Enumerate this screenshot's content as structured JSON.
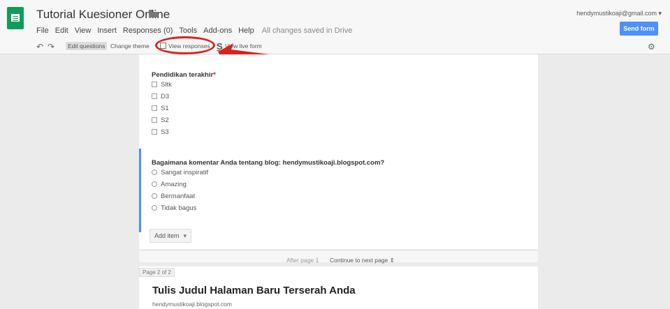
{
  "header": {
    "doc_title": "Tutorial Kuesioner Online",
    "account": "hendymustikoaji@gmail.com ▾",
    "send_form": "Send form",
    "menu": [
      "File",
      "Edit",
      "View",
      "Insert",
      "Responses (0)",
      "Tools",
      "Add-ons",
      "Help"
    ],
    "saved_status": "All changes saved in Drive"
  },
  "toolbar": {
    "edit_questions": "Edit questions",
    "change_theme": "Change theme",
    "view_responses": "View responses",
    "view_live_form": "View live form"
  },
  "colors": {
    "accent": "#4d90fe",
    "brand": "#0f9d58",
    "callout": "#d8231f"
  },
  "question1": {
    "title": "Pendidikan terakhir",
    "options": [
      "Sltk",
      "D3",
      "S1",
      "S2",
      "S3"
    ]
  },
  "question2": {
    "title": "Bagaimana komentar Anda tentang blog: hendymustikoaji.blogspot.com?",
    "options": [
      "Sangat inspiratif",
      "Amazing",
      "Bermanfaat",
      "Tidak bagus"
    ]
  },
  "add_item": "Add item",
  "after_page": "After page 1",
  "continue_next": "Continue to next page",
  "page2": {
    "tab": "Page 2 of 2",
    "title": "Tulis Judul Halaman Baru Terserah Anda",
    "subtitle": "hendymustikoaji.blogspot.com"
  }
}
